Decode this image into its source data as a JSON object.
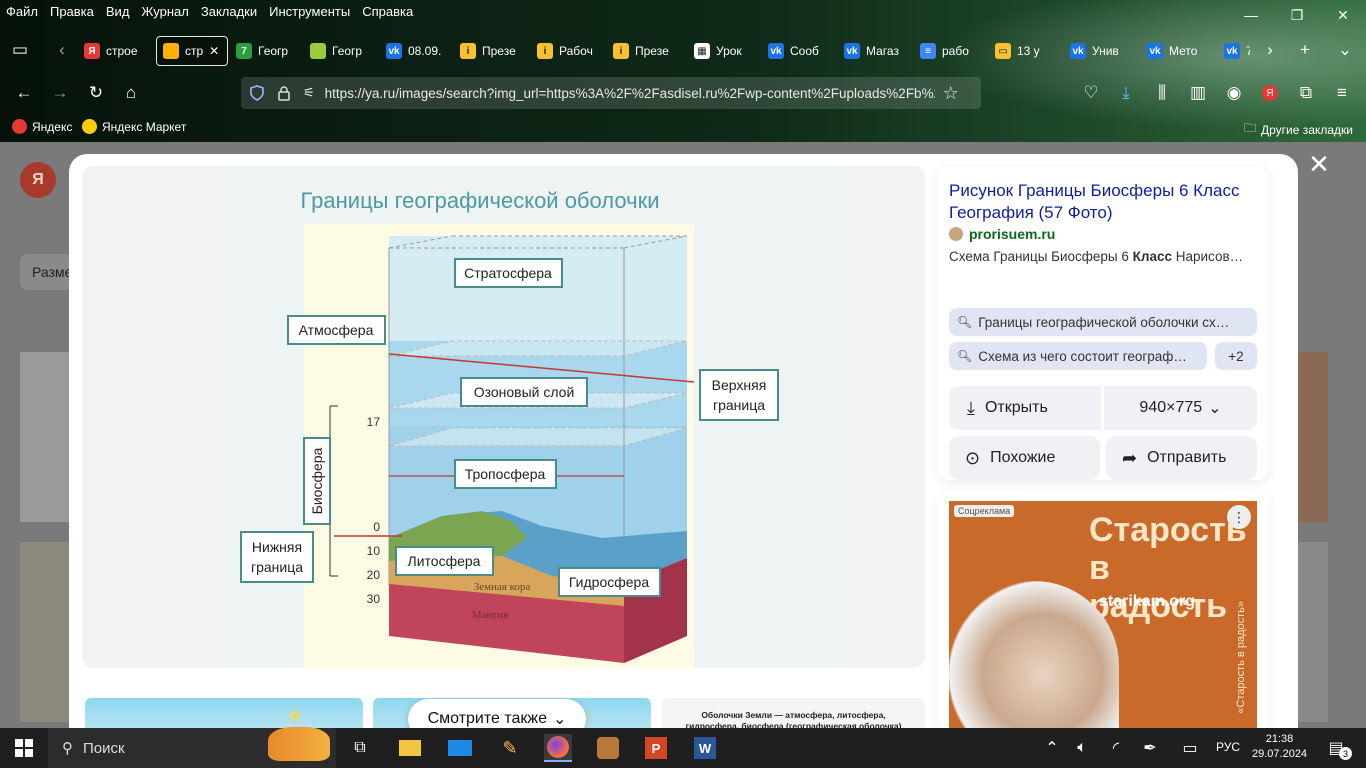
{
  "menu": [
    "Файл",
    "Правка",
    "Вид",
    "Журнал",
    "Закладки",
    "Инструменты",
    "Справка"
  ],
  "tabs": [
    {
      "label": "строе",
      "color": "#e53935",
      "glyph": "Я"
    },
    {
      "label": "стр",
      "color": "#ffb300",
      "glyph": ""
    },
    {
      "label": "Геогр",
      "color": "#2e9c3a",
      "glyph": "7"
    },
    {
      "label": "Геогр",
      "color": "#9ccc3c",
      "glyph": ""
    },
    {
      "label": "08.09.",
      "color": "#1a73e8",
      "glyph": "vk"
    },
    {
      "label": "Презе",
      "color": "#fbc02d",
      "glyph": "i"
    },
    {
      "label": "Рабоч",
      "color": "#fbc02d",
      "glyph": "i"
    },
    {
      "label": "Презе",
      "color": "#fbc02d",
      "glyph": "i"
    },
    {
      "label": "Урок",
      "color": "#ffffff",
      "glyph": "▦"
    },
    {
      "label": "Сооб",
      "color": "#1a73e8",
      "glyph": "vk"
    },
    {
      "label": "Магаз",
      "color": "#1a73e8",
      "glyph": "vk"
    },
    {
      "label": "рабо",
      "color": "#4285f4",
      "glyph": "≡"
    },
    {
      "label": "13 у",
      "color": "#fbc02d",
      "glyph": "▭"
    },
    {
      "label": "Унив",
      "color": "#1a73e8",
      "glyph": "vk"
    },
    {
      "label": "Мето",
      "color": "#1a73e8",
      "glyph": "vk"
    },
    {
      "label": "7",
      "color": "#1a73e8",
      "glyph": "vk"
    }
  ],
  "url": "https://ya.ru/images/search?img_url=https%3A%2F%2Fasdisel.ru%2Fwp-content%2Fuploads%2Fb%2",
  "bookmarks": {
    "yandex": "Яндекс",
    "market": "Яндекс Маркет",
    "other": "Другие закладки"
  },
  "page": {
    "side_label": "Разме"
  },
  "diagram": {
    "title": "Границы географической оболочки",
    "labels": {
      "stratosphere": "Стратосфера",
      "atmosphere": "Атмосфера",
      "ozone": "Озоновый слой",
      "upper1": "Верхняя",
      "upper2": "граница",
      "troposphere": "Тропосфера",
      "biosphere": "Биосфера",
      "lower1": "Нижняя",
      "lower2": "граница",
      "lithosphere": "Литосфера",
      "hydrosphere": "Гидросфера",
      "crust": "Земная кора",
      "mantle": "Мантия"
    },
    "scale": [
      "17",
      "0",
      "10",
      "20",
      "30"
    ]
  },
  "result": {
    "title": "Рисунок Границы Биосферы 6 Класс География (57 Фото)",
    "site": "prorisuem.ru",
    "desc_pre": "Схема Границы Биосферы 6 ",
    "desc_bold": "Класс",
    "desc_post": " Нарисов…",
    "chip1": "Границы географической оболочки сх…",
    "chip2": "Схема из чего состоит географ…",
    "chip_more": "+2",
    "open": "Открыть",
    "size": "940×775",
    "similar": "Похожие",
    "share": "Отправить"
  },
  "ad": {
    "badge": "Соцреклама",
    "line1": "Старость",
    "line2": "в радость",
    "site": "starikam.org",
    "vertical": "«Старость в радость»"
  },
  "see_also": "Смотрите также",
  "thumb3_text": "Оболочки Земли — атмосфера, литосфера, гидросфера, биосфера (географическая оболочка)",
  "taskbar": {
    "search": "Поиск",
    "lang": "РУС",
    "time": "21:38",
    "date": "29.07.2024",
    "badge": "3"
  }
}
